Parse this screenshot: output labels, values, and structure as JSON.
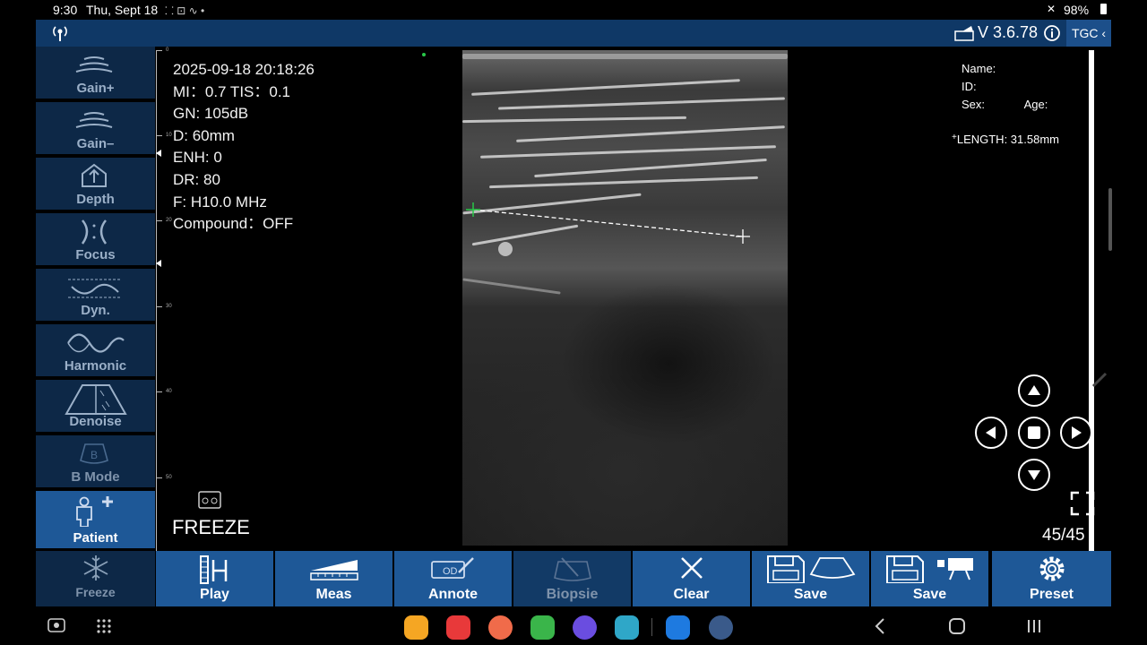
{
  "status_bar": {
    "time": "9:30",
    "date": "Thu, Sept 18",
    "battery": "98%"
  },
  "header": {
    "version": "V 3.6.78",
    "tgc_label": "TGC"
  },
  "left_panel": [
    {
      "key": "gain_plus",
      "label": "Gain+",
      "icon": "gain-plus-icon"
    },
    {
      "key": "gain_minus",
      "label": "Gain–",
      "icon": "gain-minus-icon"
    },
    {
      "key": "depth",
      "label": "Depth",
      "icon": "depth-icon"
    },
    {
      "key": "focus",
      "label": "Focus",
      "icon": "focus-icon"
    },
    {
      "key": "dyn",
      "label": "Dyn.",
      "icon": "dynamic-range-icon"
    },
    {
      "key": "harmonic",
      "label": "Harmonic",
      "icon": "harmonic-icon"
    },
    {
      "key": "denoise",
      "label": "Denoise",
      "icon": "denoise-icon"
    },
    {
      "key": "bmode",
      "label": "B Mode",
      "icon": "b-mode-icon"
    },
    {
      "key": "patient",
      "label": "Patient",
      "icon": "patient-icon",
      "active": true
    }
  ],
  "freeze_button": {
    "label": "Freeze",
    "icon": "snowflake-icon"
  },
  "info": {
    "datetime": "2025-09-18 20:18:26",
    "mi_tis": "MI：0.7  TIS：0.1",
    "gain": "GN: 105dB",
    "depth": "D: 60mm",
    "enh": "ENH: 0",
    "dr": "DR: 80",
    "freq": "F: H10.0 MHz",
    "compound": "Compound：OFF"
  },
  "ruler": {
    "labels": [
      "0",
      "10",
      "20",
      "30",
      "40",
      "50"
    ]
  },
  "freeze_status": "FREEZE",
  "patient": {
    "name_label": "Name:",
    "id_label": "ID:",
    "sex_label": "Sex:",
    "age_label": "Age:"
  },
  "measurement": {
    "text": "LENGTH: 31.58mm",
    "value_mm": 31.58
  },
  "frame_counter": "45/45",
  "toolbar": [
    {
      "key": "play",
      "label": "Play",
      "icon": "play-film-icon"
    },
    {
      "key": "meas",
      "label": "Meas",
      "icon": "measure-ruler-icon"
    },
    {
      "key": "annote",
      "label": "Annote",
      "icon": "annotate-pen-icon"
    },
    {
      "key": "biopsie",
      "label": "Biopsie",
      "icon": "biopsy-needle-icon",
      "disabled": true
    },
    {
      "key": "clear",
      "label": "Clear",
      "icon": "close-x-icon"
    },
    {
      "key": "save_image",
      "label": "Save",
      "icon": "save-image-icon"
    },
    {
      "key": "save_video",
      "label": "Save",
      "icon": "save-video-icon"
    },
    {
      "key": "preset",
      "label": "Preset",
      "icon": "gear-icon"
    }
  ],
  "colors": {
    "header": "#0f3866",
    "button": "#1e5897",
    "panel": "#0d2847",
    "accent": "#28c848"
  }
}
